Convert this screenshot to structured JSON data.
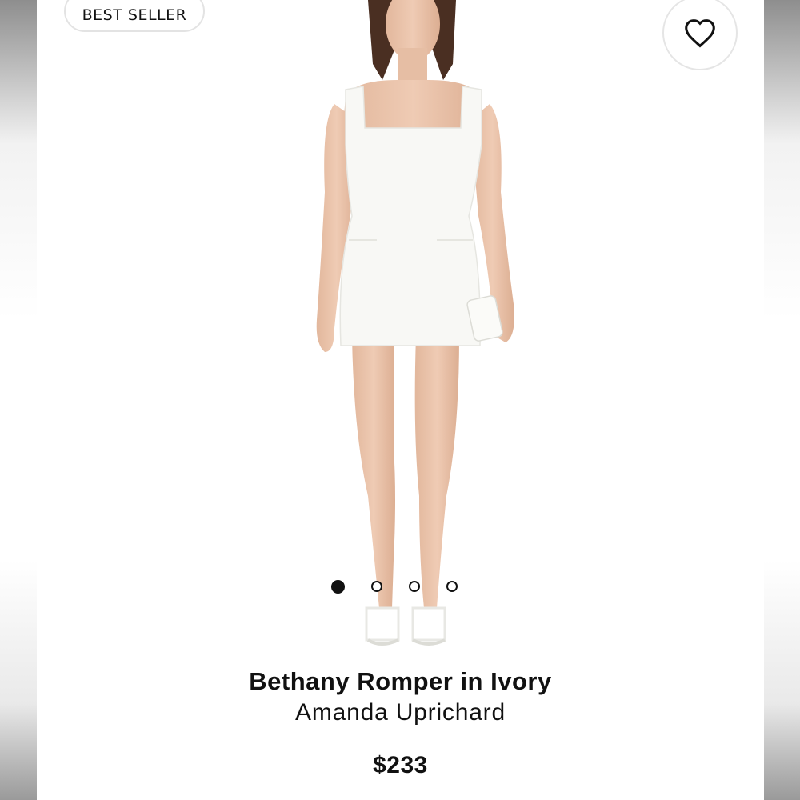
{
  "badge": {
    "label": "BEST SELLER"
  },
  "favorite": {
    "icon": "heart-icon"
  },
  "gallery": {
    "image": "product-photo-model-white-romper",
    "slide_count": 4,
    "active_index": 0
  },
  "product": {
    "name": "Bethany Romper in Ivory",
    "brand": "Amanda Uprichard",
    "price": "$233"
  },
  "colors": {
    "text": "#111111",
    "border": "#e3e3e3",
    "skin": "#e9c2a9",
    "garment": "#f8f8f5"
  }
}
